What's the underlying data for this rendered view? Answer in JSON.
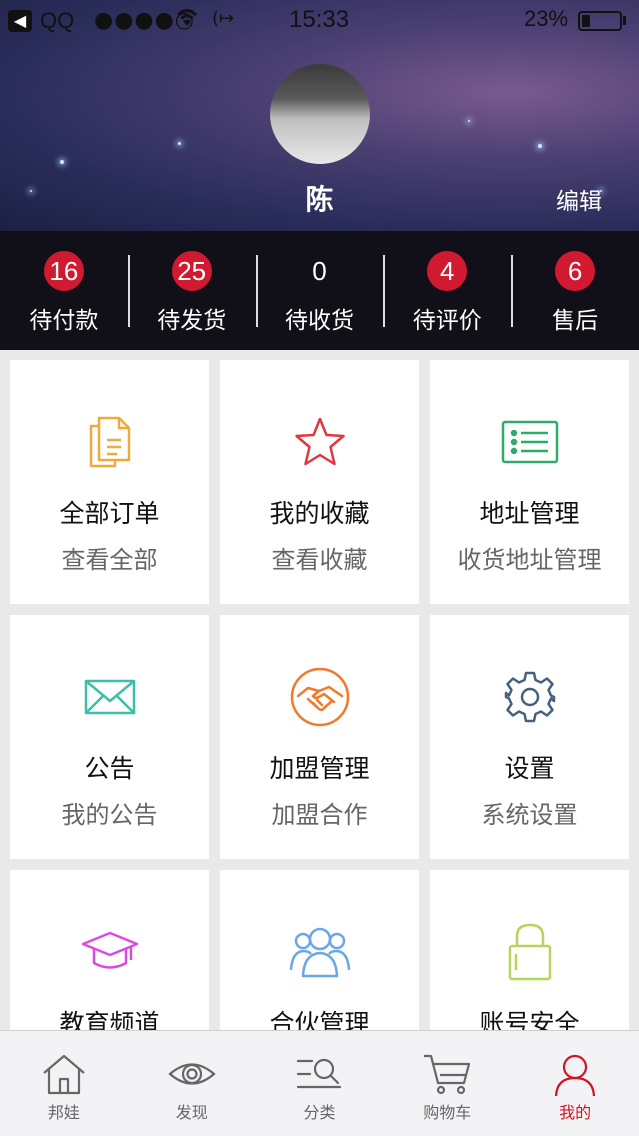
{
  "status_bar": {
    "back": "◀",
    "app": "QQ",
    "signal": "●●●●○",
    "time": "15:33",
    "battery": "23%",
    "battery_level": 0.23
  },
  "profile": {
    "name": "陈",
    "edit_label": "编辑"
  },
  "orders": [
    {
      "count": "16",
      "label": "待付款",
      "highlight": true
    },
    {
      "count": "25",
      "label": "待发货",
      "highlight": true
    },
    {
      "count": "0",
      "label": "待收货",
      "highlight": false
    },
    {
      "count": "4",
      "label": "待评价",
      "highlight": true
    },
    {
      "count": "6",
      "label": "售后",
      "highlight": true
    }
  ],
  "menu": [
    {
      "title": "全部订单",
      "subtitle": "查看全部",
      "icon": "orders-icon",
      "color": "#f0a93b"
    },
    {
      "title": "我的收藏",
      "subtitle": "查看收藏",
      "icon": "star-icon",
      "color": "#e0363f"
    },
    {
      "title": "地址管理",
      "subtitle": "收货地址管理",
      "icon": "address-list-icon",
      "color": "#2eaa6a"
    },
    {
      "title": "公告",
      "subtitle": "我的公告",
      "icon": "envelope-icon",
      "color": "#3bbfa8"
    },
    {
      "title": "加盟管理",
      "subtitle": "加盟合作",
      "icon": "handshake-icon",
      "color": "#f07a2a"
    },
    {
      "title": "设置",
      "subtitle": "系统设置",
      "icon": "gear-icon",
      "color": "#47607c"
    },
    {
      "title": "教育频道",
      "subtitle": "",
      "icon": "graduation-cap-icon",
      "color": "#d94be0"
    },
    {
      "title": "合伙管理",
      "subtitle": "",
      "icon": "group-icon",
      "color": "#6aa6e8"
    },
    {
      "title": "账号安全",
      "subtitle": "",
      "icon": "lock-icon",
      "color": "#b5d65a"
    }
  ],
  "tabbar": [
    {
      "label": "邦娃",
      "icon": "home-icon",
      "active": false
    },
    {
      "label": "发现",
      "icon": "eye-icon",
      "active": false
    },
    {
      "label": "分类",
      "icon": "category-search-icon",
      "active": false
    },
    {
      "label": "购物车",
      "icon": "cart-icon",
      "active": false
    },
    {
      "label": "我的",
      "icon": "user-icon",
      "active": true
    }
  ],
  "colors": {
    "accent": "#d01423",
    "badge": "#d11a2f",
    "order_bar": "#111018"
  }
}
